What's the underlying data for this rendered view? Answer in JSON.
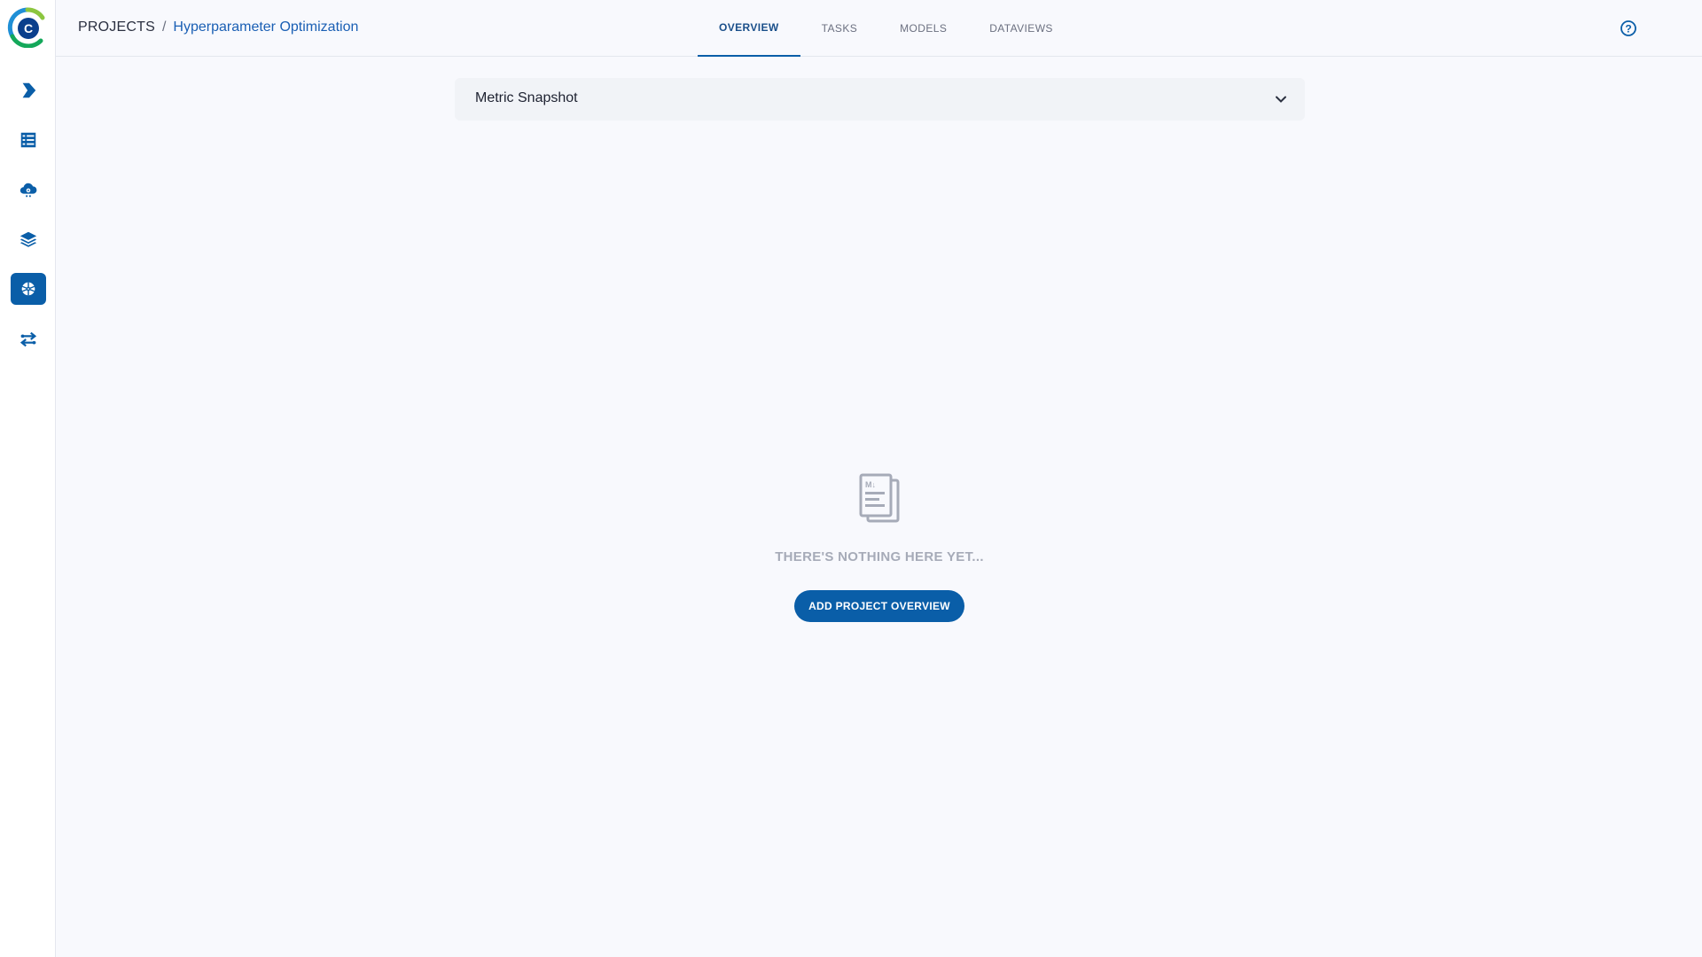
{
  "breadcrumb": {
    "root": "PROJECTS",
    "separator": "/",
    "current": "Hyperparameter Optimization"
  },
  "tabs": [
    {
      "label": "OVERVIEW",
      "active": true
    },
    {
      "label": "TASKS",
      "active": false
    },
    {
      "label": "MODELS",
      "active": false
    },
    {
      "label": "DATAVIEWS",
      "active": false
    }
  ],
  "sidebar": {
    "items": [
      {
        "icon": "pipeline-arrow-icon",
        "active": false
      },
      {
        "icon": "datasets-grid-icon",
        "active": false
      },
      {
        "icon": "cloud-gear-icon",
        "active": false
      },
      {
        "icon": "layers-icon",
        "active": false
      },
      {
        "icon": "brain-icon",
        "active": true
      },
      {
        "icon": "arrows-swap-icon",
        "active": false
      }
    ]
  },
  "header": {
    "help_icon": "help-circle-icon",
    "avatar_icon": "user-icon"
  },
  "main": {
    "metric_snapshot_title": "Metric Snapshot",
    "empty_message": "THERE'S NOTHING HERE YET...",
    "add_button_label": "ADD PROJECT OVERVIEW"
  },
  "colors": {
    "accent": "#0a5ea8",
    "breadcrumb_link": "#1a5fb4",
    "background": "#f8f9fd",
    "muted_text": "#a6abb8"
  }
}
